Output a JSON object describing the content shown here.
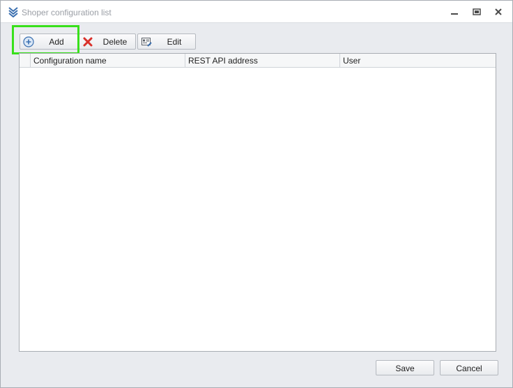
{
  "window": {
    "title": "Shoper configuration list"
  },
  "toolbar": {
    "add_label": "Add",
    "delete_label": "Delete",
    "edit_label": "Edit"
  },
  "grid": {
    "columns": [
      "Configuration name",
      "REST API address",
      "User"
    ],
    "rows": []
  },
  "footer": {
    "save_label": "Save",
    "cancel_label": "Cancel"
  },
  "icons": {
    "app": "app-chevrons-icon",
    "add": "add-circle-icon",
    "delete": "delete-x-icon",
    "edit": "edit-card-icon"
  },
  "colors": {
    "highlight": "#38e01b",
    "accent": "#3a6fb0",
    "delete": "#d9302b"
  }
}
